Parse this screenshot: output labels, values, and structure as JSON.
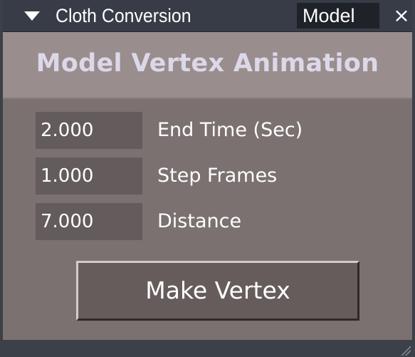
{
  "window": {
    "title": "Cloth Conversion",
    "tab_label": "Model",
    "collapse_icon": "triangle-down-icon",
    "close_icon": "close-icon",
    "close_glyph": "×"
  },
  "header": {
    "title": "Model Vertex Animation"
  },
  "fields": [
    {
      "value": "2.000",
      "label": "End Time (Sec)"
    },
    {
      "value": "1.000",
      "label": "Step Frames"
    },
    {
      "value": "7.000",
      "label": "Distance"
    }
  ],
  "actions": {
    "make_vertex_label": "Make Vertex"
  },
  "colors": {
    "panel_bg": "#7a7170",
    "titlebar_bg": "#373c47",
    "header_bg": "#998e8d",
    "header_text": "#dcd8ea",
    "field_bg": "#645c5c",
    "button_bg": "#675c5c"
  }
}
